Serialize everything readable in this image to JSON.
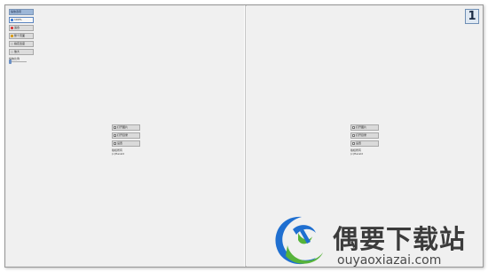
{
  "toolbar": {
    "header": "缩放选项",
    "buttons": [
      {
        "label": "100%",
        "icon": "radio-icon",
        "color": "#2a6fd1",
        "active": true
      },
      {
        "label": "适合",
        "icon": "red-dot-icon",
        "color": "#d92b2b",
        "active": false
      },
      {
        "label": "整个页面",
        "icon": "page-icon",
        "color": "#d9a020",
        "active": false
      },
      {
        "label": "指定宽度",
        "icon": "width-icon",
        "color": "#c8c8c8",
        "active": false
      },
      {
        "label": "放大",
        "icon": "zoom-icon",
        "color": "#c8c8c8",
        "active": false
      }
    ],
    "zoom_label": "缩放比例"
  },
  "left_panel": {
    "buttons": [
      "打开图片",
      "打开目录",
      "设置"
    ],
    "info_lines": [
      "版权所有",
      "(c)Harald"
    ]
  },
  "right_panel": {
    "buttons": [
      "打开图片",
      "打开目录",
      "设置"
    ],
    "info_lines": [
      "版权所有",
      "(c)Harald"
    ]
  },
  "page_badge": "1",
  "watermark": {
    "title": "偶要下载站",
    "url": "ouyaoxiazai.com",
    "colors": {
      "blue": "#1f6fd0",
      "green": "#56b33a"
    }
  }
}
